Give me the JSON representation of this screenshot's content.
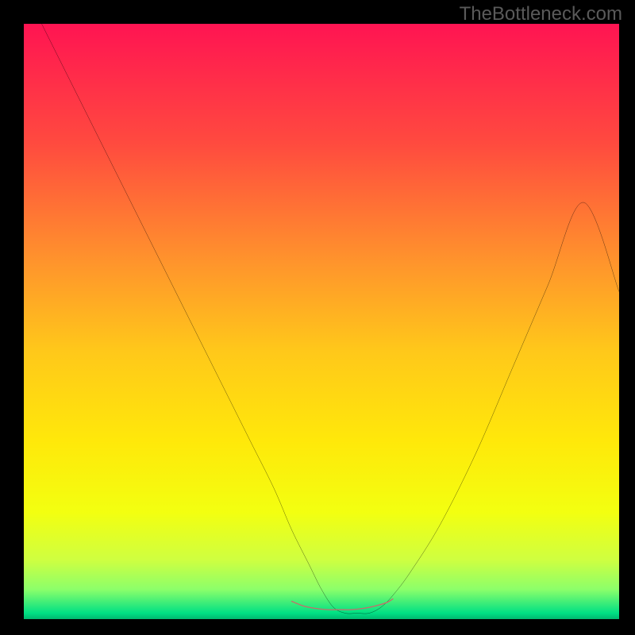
{
  "attribution": {
    "watermark": "TheBottleneck.com"
  },
  "chart_data": {
    "type": "line",
    "title": "",
    "xlabel": "",
    "ylabel": "",
    "xlim": [
      0,
      100
    ],
    "ylim": [
      0,
      100
    ],
    "grid": false,
    "legend": false,
    "background_gradient_stops": [
      {
        "pos": 0.0,
        "color": "#ff1452"
      },
      {
        "pos": 0.2,
        "color": "#ff4a3f"
      },
      {
        "pos": 0.4,
        "color": "#ff942c"
      },
      {
        "pos": 0.55,
        "color": "#ffc81a"
      },
      {
        "pos": 0.7,
        "color": "#ffe80a"
      },
      {
        "pos": 0.82,
        "color": "#f3ff10"
      },
      {
        "pos": 0.9,
        "color": "#cfff40"
      },
      {
        "pos": 0.95,
        "color": "#8cff6a"
      },
      {
        "pos": 0.99,
        "color": "#00e084"
      },
      {
        "pos": 1.0,
        "color": "#00b86f"
      }
    ],
    "series": [
      {
        "name": "bottleneck-curve",
        "color": "#000000",
        "width": 2,
        "x": [
          3,
          8,
          13,
          18,
          23,
          28,
          33,
          38,
          42,
          45,
          48,
          50,
          52,
          54,
          56,
          58,
          60,
          62,
          65,
          70,
          76,
          82,
          88,
          94,
          100
        ],
        "y": [
          100,
          90,
          80,
          70,
          60,
          50,
          40,
          30,
          22,
          15,
          9,
          5,
          2,
          1,
          1,
          1,
          2,
          4,
          8,
          16,
          28,
          42,
          56,
          70,
          55
        ]
      },
      {
        "name": "optimal-range-marker",
        "color": "#c96b6b",
        "width": 10,
        "x": [
          45,
          47,
          49,
          51,
          53,
          55,
          57,
          59,
          61,
          62
        ],
        "y": [
          3,
          2.2,
          1.8,
          1.6,
          1.6,
          1.6,
          1.8,
          2.2,
          2.8,
          3.4
        ]
      }
    ],
    "notes": "Axes are unlabeled in the source image; x/y units are relative (0–100). The black curve is a V-shaped bottleneck profile reaching its minimum near x≈54. The muted-red thick segment highlights the near-zero optimal band roughly x∈[45,62]."
  }
}
